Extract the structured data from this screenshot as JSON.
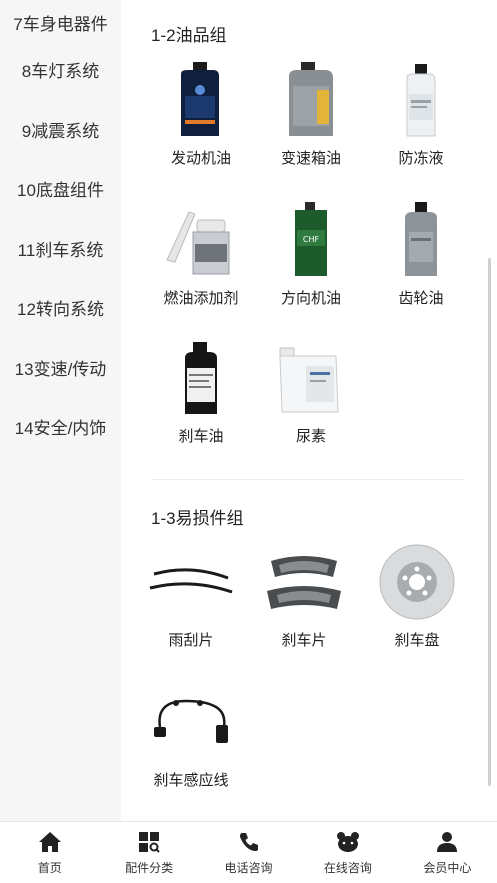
{
  "sidebar": {
    "items": [
      {
        "label": "7车身电器件"
      },
      {
        "label": "8车灯系统"
      },
      {
        "label": "9减震系统"
      },
      {
        "label": "10底盘组件"
      },
      {
        "label": "11刹车系统"
      },
      {
        "label": "12转向系统"
      },
      {
        "label": "13变速/传动"
      },
      {
        "label": "14安全/内饰"
      }
    ]
  },
  "sections": [
    {
      "title": "1-2油品组",
      "products": [
        {
          "label": "发动机油",
          "icon": "engine-oil-bottle"
        },
        {
          "label": "变速箱油",
          "icon": "transmission-oil-bottle"
        },
        {
          "label": "防冻液",
          "icon": "antifreeze-bottle"
        },
        {
          "label": "燃油添加剂",
          "icon": "fuel-additive-can"
        },
        {
          "label": "方向机油",
          "icon": "steering-oil-can"
        },
        {
          "label": "齿轮油",
          "icon": "gear-oil-bottle"
        },
        {
          "label": "刹车油",
          "icon": "brake-fluid-bottle"
        },
        {
          "label": "尿素",
          "icon": "urea-container"
        }
      ]
    },
    {
      "title": "1-3易损件组",
      "products": [
        {
          "label": "雨刮片",
          "icon": "wiper-blades"
        },
        {
          "label": "刹车片",
          "icon": "brake-pads"
        },
        {
          "label": "刹车盘",
          "icon": "brake-disc"
        },
        {
          "label": "刹车感应线",
          "icon": "brake-sensor-wire"
        }
      ]
    }
  ],
  "bottom_nav": [
    {
      "label": "首页",
      "icon": "home-icon"
    },
    {
      "label": "配件分类",
      "icon": "category-icon"
    },
    {
      "label": "电话咨询",
      "icon": "phone-icon"
    },
    {
      "label": "在线咨询",
      "icon": "chat-icon"
    },
    {
      "label": "会员中心",
      "icon": "user-icon"
    }
  ]
}
